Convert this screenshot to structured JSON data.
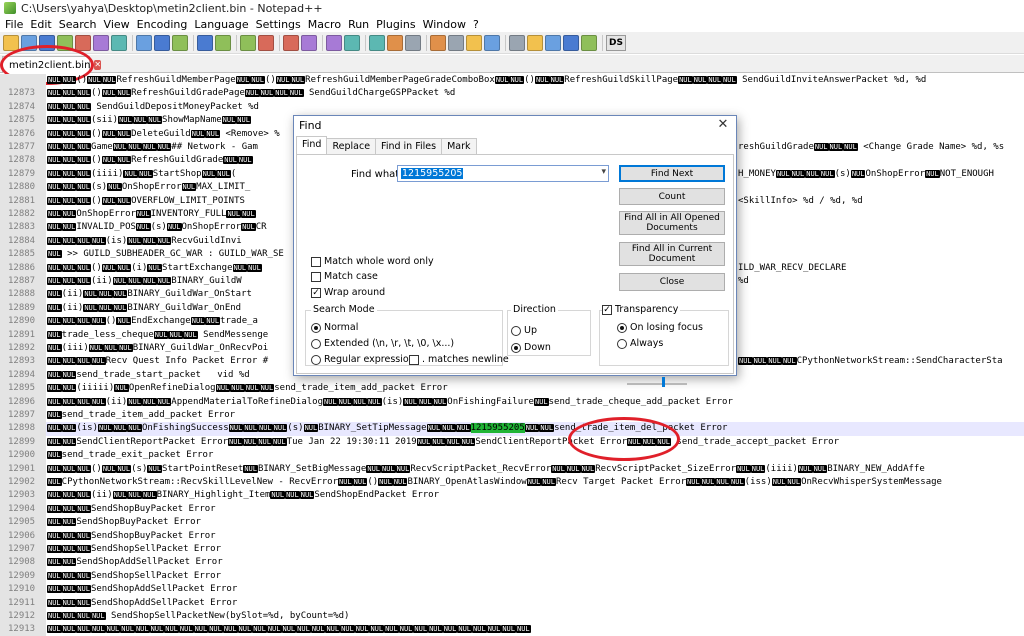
{
  "window": {
    "title": "C:\\Users\\yahya\\Desktop\\metin2client.bin - Notepad++"
  },
  "menu": [
    "File",
    "Edit",
    "Search",
    "View",
    "Encoding",
    "Language",
    "Settings",
    "Macro",
    "Run",
    "Plugins",
    "Window",
    "?"
  ],
  "toolbar": {
    "groups": [
      [
        "new-file",
        "open-file",
        "save",
        "save-all",
        "close",
        "close-all",
        "print"
      ],
      [
        "cut",
        "copy",
        "paste"
      ],
      [
        "undo",
        "redo"
      ],
      [
        "find",
        "replace"
      ],
      [
        "zoom-in",
        "zoom-out"
      ],
      [
        "sync-vertical",
        "sync-horizontal"
      ],
      [
        "word-wrap",
        "show-all-chars",
        "indent-guide"
      ],
      [
        "user-language",
        "doc-map",
        "function-list",
        "folder-workspace"
      ],
      [
        "macro-record",
        "macro-stop",
        "macro-play",
        "macro-play-multiple",
        "macro-save"
      ]
    ],
    "ds_label": "DS"
  },
  "tab": {
    "label": "metin2client.bin",
    "close": "✕"
  },
  "editor": {
    "nul_token": "NUL",
    "current_line": "12898",
    "rows": [
      {
        "n": "",
        "code": "[N][N]()[N][N]RefreshGuildMemberPage[N][N]()[N][N]RefreshGuildMemberPageGradeComboBox[N][N]()[N][N]RefreshGuildSkillPage[N][N][N][N] SendGuildInviteAnswerPacket %d, %d"
      },
      {
        "n": "12873",
        "code": "[N][N][N]()[N][N]RefreshGuildGradePage[N][N][N][N] SendGuildChargeGSPPacket %d"
      },
      {
        "n": "12874",
        "code": "[N][N][N] SendGuildDepositMoneyPacket %d"
      },
      {
        "n": "12875",
        "code": "[N][N][N](sii)[N][N][N]ShowMapName[N][N]"
      },
      {
        "n": "12876",
        "code": "[N][N][N]()[N][N]DeleteGuild[N][N] <Remove> %"
      },
      {
        "n": "12877",
        "code": "[N][N][N]Game[N][N][N][N]## Network - Gam"
      },
      {
        "n": "12878",
        "code": "[N][N][N]()[N][N]RefreshGuildGrade[N][N]"
      },
      {
        "n": "12879",
        "code": "[N][N][N](iiii)[N][N]StartShop[N][N]("
      },
      {
        "n": "12880",
        "code": "[N][N][N](s)[N]OnShopError[N]MAX_LIMIT_"
      },
      {
        "n": "12881",
        "code": "[N][N][N]()[N][N]OVERFLOW_LIMIT_POINTS"
      },
      {
        "n": "12882",
        "code": "[N][N]OnShopError[N]INVENTORY_FULL[N][N]"
      },
      {
        "n": "12883",
        "code": "[N][N]INVALID_POS[N](s)[N]OnShopError[N]CR"
      },
      {
        "n": "12884",
        "code": "[N][N][N][N](is)[N][N][N]RecvGuildInvi"
      },
      {
        "n": "12885",
        "code": "[N] >> GUILD_SUBHEADER_GC_WAR : GUILD_WAR_SE"
      },
      {
        "n": "12886",
        "code": "[N][N][N]()[N][N](i)[N]StartExchange[N][N]"
      },
      {
        "n": "12887",
        "code": "[N][N][N](ii)[N][N][N][N]BINARY_GuildW"
      },
      {
        "n": "12888",
        "code": "[N](ii)[N][N][N]BINARY_GuildWar_OnStart"
      },
      {
        "n": "12889",
        "code": "[N](ii)[N][N][N]BINARY_GuildWar_OnEnd"
      },
      {
        "n": "12890",
        "code": "[N][N][N][N]()[N]EndExchange[N][N]trade_a"
      },
      {
        "n": "12891",
        "code": "[N]trade_less_cheque[N][N][N] SendMessenge"
      },
      {
        "n": "12892",
        "code": "[N](iii)[N][N][N]BINARY_GuildWar_OnRecvPoi"
      },
      {
        "n": "12893",
        "code": "[N][N][N][N]Recv Quest Info Packet Error #"
      },
      {
        "n": "12894",
        "code": "[N][N]send_trade_start_packet   vid %d"
      },
      {
        "n": "12895",
        "code": "[N][N](iiiii)[N]OpenRefineDialog[N][N][N][N]send_trade_item_add_packet Error"
      },
      {
        "n": "12896",
        "code": "[N][N][N][N](ii)[N][N][N]AppendMaterialToRefineDialog[N][N][N][N](is)[N][N][N]OnFishingFailure[N]send_trade_cheque_add_packet Error"
      },
      {
        "n": "12897",
        "code": "[N]send_trade_item_add_packet Error"
      },
      {
        "n": "12898",
        "code": "[N][N](is)[N][N][N]OnFishingSuccess[N][N][N][N](s)[N]BINARY_SetTipMessage[N][N][N]{1215955205}[N][N]send_trade_item_del_packet Error"
      },
      {
        "n": "12899",
        "code": "[N][N]SendClientReportPacket Error[N][N][N][N]Tue Jan 22 19:30:11 2019[N][N][N][N]SendClientReportPacket Error[N][N][N] send_trade_accept_packet Error"
      },
      {
        "n": "12900",
        "code": "[N]send_trade_exit_packet Error"
      },
      {
        "n": "12901",
        "code": "[N][N][N]()[N][N](s)[N]StartPointReset[N]BINARY_SetBigMessage[N][N][N]RecvScriptPacket_RecvError[N][N][N]RecvScriptPacket_SizeError[N][N](iiii)[N][N]BINARY_NEW_AddAffe"
      },
      {
        "n": "12902",
        "code": "[N]CPythonNetworkStream::RecvSkillLevelNew - RecvError[N][N]()[N][N]BINARY_OpenAtlasWindow[N][N]Recv Target Packet Error[N][N][N][N](iss)[N][N]OnRecvWhisperSystemMessage"
      },
      {
        "n": "12903",
        "code": "[N][N][N](ii)[N][N][N]BINARY_Highlight_Item[N][N][N]SendShopEndPacket Error"
      },
      {
        "n": "12904",
        "code": "[N][N][N]SendShopBuyPacket Error"
      },
      {
        "n": "12905",
        "code": "[N][N]SendShopBuyPacket Error"
      },
      {
        "n": "12906",
        "code": "[N][N][N]SendShopBuyPacket Error"
      },
      {
        "n": "12907",
        "code": "[N][N][N]SendShopSellPacket Error"
      },
      {
        "n": "12908",
        "code": "[N][N]SendShopAddSellPacket Error"
      },
      {
        "n": "12909",
        "code": "[N][N][N]SendShopSellPacket Error"
      },
      {
        "n": "12910",
        "code": "[N][N][N]SendShopAddSellPacket Error"
      },
      {
        "n": "12911",
        "code": "[N][N][N]SendShopAddSellPacket Error"
      },
      {
        "n": "12912",
        "code": "[N][N][N][N] SendShopSellPacketNew(bySlot=%d, byCount=%d)"
      },
      {
        "n": "12913",
        "code": "[N][N][N][N][N][N][N][N][N][N][N][N][N][N][N][N][N][N][N][N][N][N][N][N][N][N][N][N][N][N][N][N][N]"
      }
    ],
    "right_fragments": {
      "12877": "reshGuildGrade[N][N][N] <Change Grade Name> %d, %s",
      "12879": "H_MONEY[N][N][N][N](s)[N]OnShopError[N]NOT_ENOUGH",
      "12881": "<SkillInfo> %d / %d, %d",
      "12886": "ILD_WAR_RECV_DECLARE",
      "12887": "%d",
      "12893": "[N][N][N][N]CPythonNetworkStream::SendCharacterSta"
    }
  },
  "find": {
    "title": "Find",
    "close": "✕",
    "tabs": [
      "Find",
      "Replace",
      "Find in Files",
      "Mark"
    ],
    "find_what_label": "Find what :",
    "find_what_value": "1215955205",
    "buttons": {
      "find_next": "Find Next",
      "count": "Count",
      "find_all_opened": "Find All in All Opened Documents",
      "find_all_current": "Find All in Current Document",
      "close": "Close"
    },
    "options": {
      "match_whole_word": {
        "label": "Match whole word only",
        "checked": false
      },
      "match_case": {
        "label": "Match case",
        "checked": false
      },
      "wrap_around": {
        "label": "Wrap around",
        "checked": true
      }
    },
    "search_mode": {
      "label": "Search Mode",
      "normal": "Normal",
      "extended": "Extended (\\n, \\r, \\t, \\0, \\x...)",
      "regex": "Regular expression",
      "matches_newline": ". matches newline",
      "selected": "normal"
    },
    "direction": {
      "label": "Direction",
      "up": "Up",
      "down": "Down",
      "selected": "down"
    },
    "transparency": {
      "label": "Transparency",
      "checked": true,
      "on_losing_focus": "On losing focus",
      "always": "Always",
      "selected": "on_losing_focus",
      "level": 0.6
    }
  },
  "annotation_color": "#e0202a"
}
